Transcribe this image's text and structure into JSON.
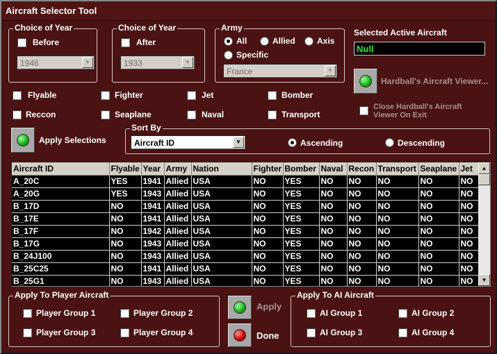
{
  "window": {
    "title": "Aircraft Selector Tool"
  },
  "year_before": {
    "title": "Choice of Year",
    "label": "Before",
    "value": "1946"
  },
  "year_after": {
    "title": "Choice of Year",
    "label": "After",
    "value": "1933"
  },
  "army": {
    "title": "Army",
    "all": "All",
    "allied": "Allied",
    "axis": "Axis",
    "specific": "Specific",
    "selected": "all",
    "country": "France"
  },
  "active_aircraft": {
    "label": "Selected Active Aircraft",
    "value": "Null"
  },
  "viewer": {
    "label": "Hardball's Aircraft Viewer...",
    "close_label_1": "Close Hardball's Aircraft",
    "close_label_2": "Viewer On Exit"
  },
  "filters": {
    "flyable": "Flyable",
    "fighter": "Fighter",
    "jet": "Jet",
    "bomber": "Bomber",
    "reccon": "Reccon",
    "seaplane": "Seaplane",
    "naval": "Naval",
    "transport": "Transport"
  },
  "apply_selections": {
    "label": "Apply Selections"
  },
  "sort": {
    "title": "Sort By",
    "value": "Aircraft ID",
    "ascending": "Ascending",
    "descending": "Descending",
    "order": "ascending"
  },
  "table": {
    "columns": [
      "Aircraft ID",
      "Flyable",
      "Year",
      "Army",
      "Nation",
      "Fighter",
      "Bomber",
      "Naval",
      "Recon",
      "Transport",
      "Seaplane",
      "Jet"
    ],
    "rows": [
      [
        "A_20C",
        "YES",
        "1941",
        "Allied",
        "USA",
        "NO",
        "YES",
        "NO",
        "NO",
        "NO",
        "NO",
        "NO"
      ],
      [
        "A_20G",
        "YES",
        "1943",
        "Allied",
        "USA",
        "NO",
        "YES",
        "NO",
        "NO",
        "NO",
        "NO",
        "NO"
      ],
      [
        "B_17D",
        "NO",
        "1941",
        "Allied",
        "USA",
        "NO",
        "YES",
        "NO",
        "NO",
        "NO",
        "NO",
        "NO"
      ],
      [
        "B_17E",
        "NO",
        "1941",
        "Allied",
        "USA",
        "NO",
        "YES",
        "NO",
        "NO",
        "NO",
        "NO",
        "NO"
      ],
      [
        "B_17F",
        "NO",
        "1942",
        "Allied",
        "USA",
        "NO",
        "YES",
        "NO",
        "NO",
        "NO",
        "NO",
        "NO"
      ],
      [
        "B_17G",
        "NO",
        "1943",
        "Allied",
        "USA",
        "NO",
        "YES",
        "NO",
        "NO",
        "NO",
        "NO",
        "NO"
      ],
      [
        "B_24J100",
        "NO",
        "1943",
        "Allied",
        "USA",
        "NO",
        "YES",
        "NO",
        "NO",
        "NO",
        "NO",
        "NO"
      ],
      [
        "B_25C25",
        "NO",
        "1941",
        "Allied",
        "USA",
        "NO",
        "YES",
        "NO",
        "NO",
        "NO",
        "NO",
        "NO"
      ],
      [
        "B_25G1",
        "NO",
        "1943",
        "Allied",
        "USA",
        "NO",
        "YES",
        "NO",
        "NO",
        "NO",
        "NO",
        "NO"
      ]
    ]
  },
  "player_groups": {
    "title": "Apply To Player Aircraft",
    "g1": "Player Group 1",
    "g2": "Player Group 2",
    "g3": "Player Group 3",
    "g4": "Player Group 4"
  },
  "ai_groups": {
    "title": "Apply To AI Aircraft",
    "g1": "AI Group 1",
    "g2": "AI Group 2",
    "g3": "AI Group 3",
    "g4": "AI Group 4"
  },
  "buttons": {
    "apply": "Apply",
    "done": "Done"
  },
  "colors": {
    "background": "#4a1212",
    "active_text": "#2ee62e"
  }
}
